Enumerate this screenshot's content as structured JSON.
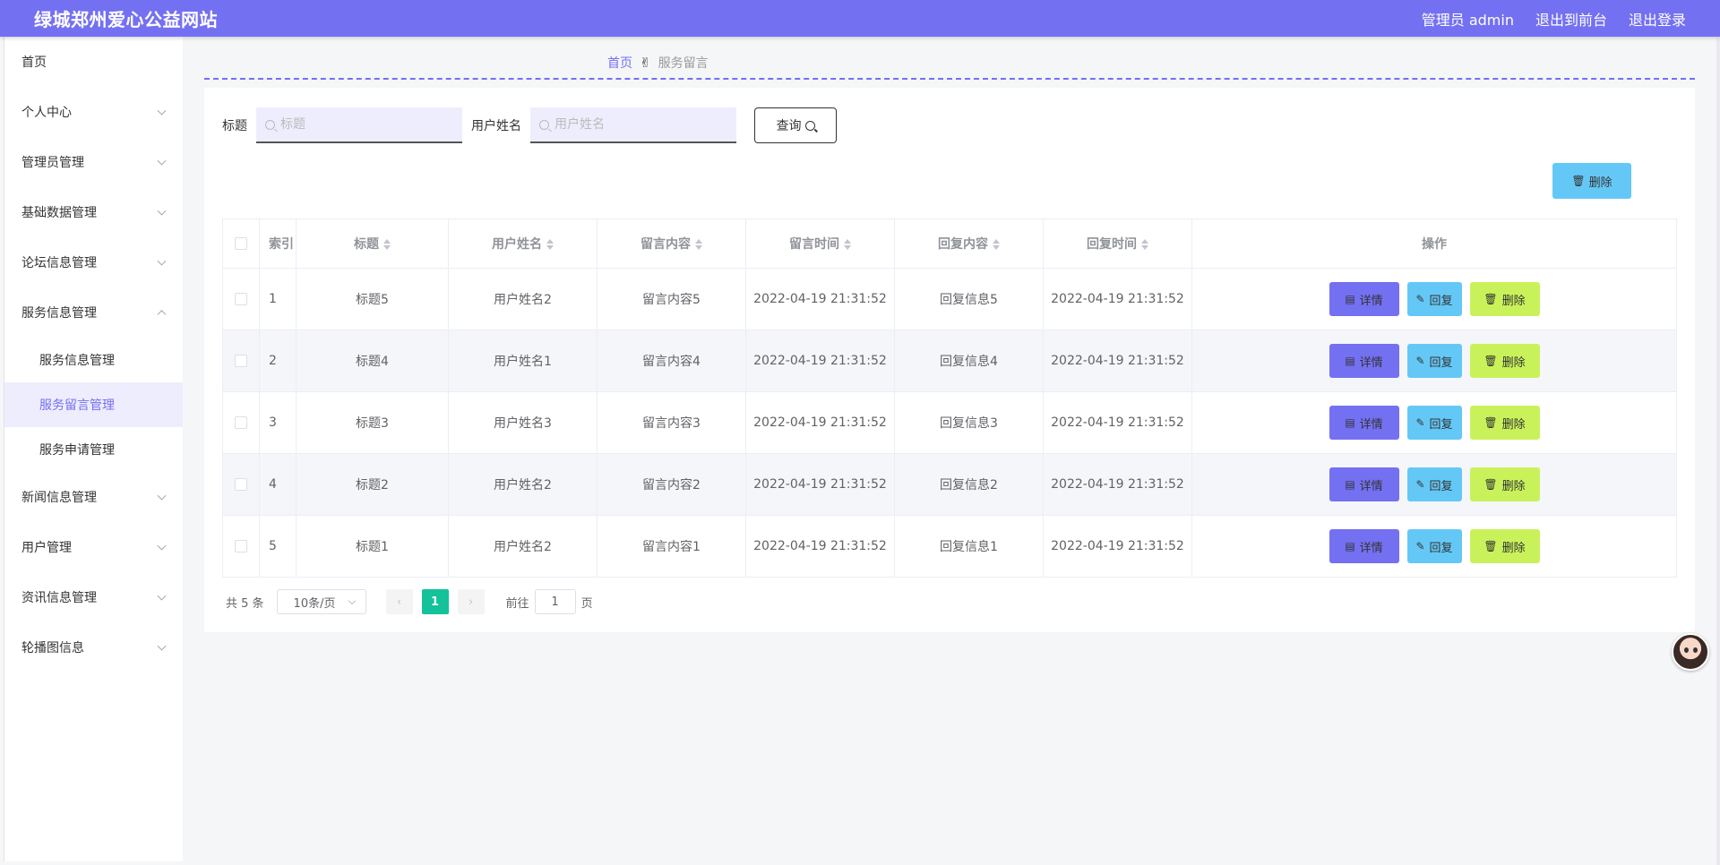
{
  "header": {
    "title": "绿城郑州爱心公益网站",
    "admin": "管理员 admin",
    "to_front": "退出到前台",
    "logout": "退出登录"
  },
  "sidebar": {
    "items": [
      {
        "label": "首页",
        "chevron": ""
      },
      {
        "label": "个人中心",
        "chevron": "down"
      },
      {
        "label": "管理员管理",
        "chevron": "down"
      },
      {
        "label": "基础数据管理",
        "chevron": "down"
      },
      {
        "label": "论坛信息管理",
        "chevron": "down"
      },
      {
        "label": "服务信息管理",
        "chevron": "up"
      }
    ],
    "sub_items": [
      {
        "label": "服务信息管理",
        "active": false
      },
      {
        "label": "服务留言管理",
        "active": true
      },
      {
        "label": "服务申请管理",
        "active": false
      }
    ],
    "items_after": [
      {
        "label": "新闻信息管理",
        "chevron": "down"
      },
      {
        "label": "用户管理",
        "chevron": "down"
      },
      {
        "label": "资讯信息管理",
        "chevron": "down"
      },
      {
        "label": "轮播图信息",
        "chevron": "down"
      }
    ]
  },
  "breadcrumb": {
    "home": "首页",
    "separator": "✌",
    "current": "服务留言"
  },
  "search": {
    "title_label": "标题",
    "title_placeholder": "标题",
    "user_label": "用户姓名",
    "user_placeholder": "用户姓名",
    "query_label": "查询"
  },
  "bulk_delete_label": "删除",
  "table": {
    "headers": {
      "index": "索引",
      "title": "标题",
      "username": "用户姓名",
      "content": "留言内容",
      "time": "留言时间",
      "reply": "回复内容",
      "reply_time": "回复时间",
      "ops": "操作"
    },
    "rows": [
      {
        "index": "1",
        "title": "标题5",
        "username": "用户姓名2",
        "content": "留言内容5",
        "time": "2022-04-19 21:31:52",
        "reply": "回复信息5",
        "reply_time": "2022-04-19 21:31:52"
      },
      {
        "index": "2",
        "title": "标题4",
        "username": "用户姓名1",
        "content": "留言内容4",
        "time": "2022-04-19 21:31:52",
        "reply": "回复信息4",
        "reply_time": "2022-04-19 21:31:52"
      },
      {
        "index": "3",
        "title": "标题3",
        "username": "用户姓名3",
        "content": "留言内容3",
        "time": "2022-04-19 21:31:52",
        "reply": "回复信息3",
        "reply_time": "2022-04-19 21:31:52"
      },
      {
        "index": "4",
        "title": "标题2",
        "username": "用户姓名2",
        "content": "留言内容2",
        "time": "2022-04-19 21:31:52",
        "reply": "回复信息2",
        "reply_time": "2022-04-19 21:31:52"
      },
      {
        "index": "5",
        "title": "标题1",
        "username": "用户姓名2",
        "content": "留言内容1",
        "time": "2022-04-19 21:31:52",
        "reply": "回复信息1",
        "reply_time": "2022-04-19 21:31:52"
      }
    ],
    "ops": {
      "detail": "详情",
      "reply": "回复",
      "delete": "删除"
    }
  },
  "pagination": {
    "total": "共 5 条",
    "page_size": "10条/页",
    "current_page": "1",
    "goto_prefix": "前往",
    "goto_value": "1",
    "goto_suffix": "页"
  },
  "colors": {
    "primary": "#7470f2",
    "info": "#64c8f7",
    "warning": "#c9f25a",
    "success": "#13c29a"
  }
}
